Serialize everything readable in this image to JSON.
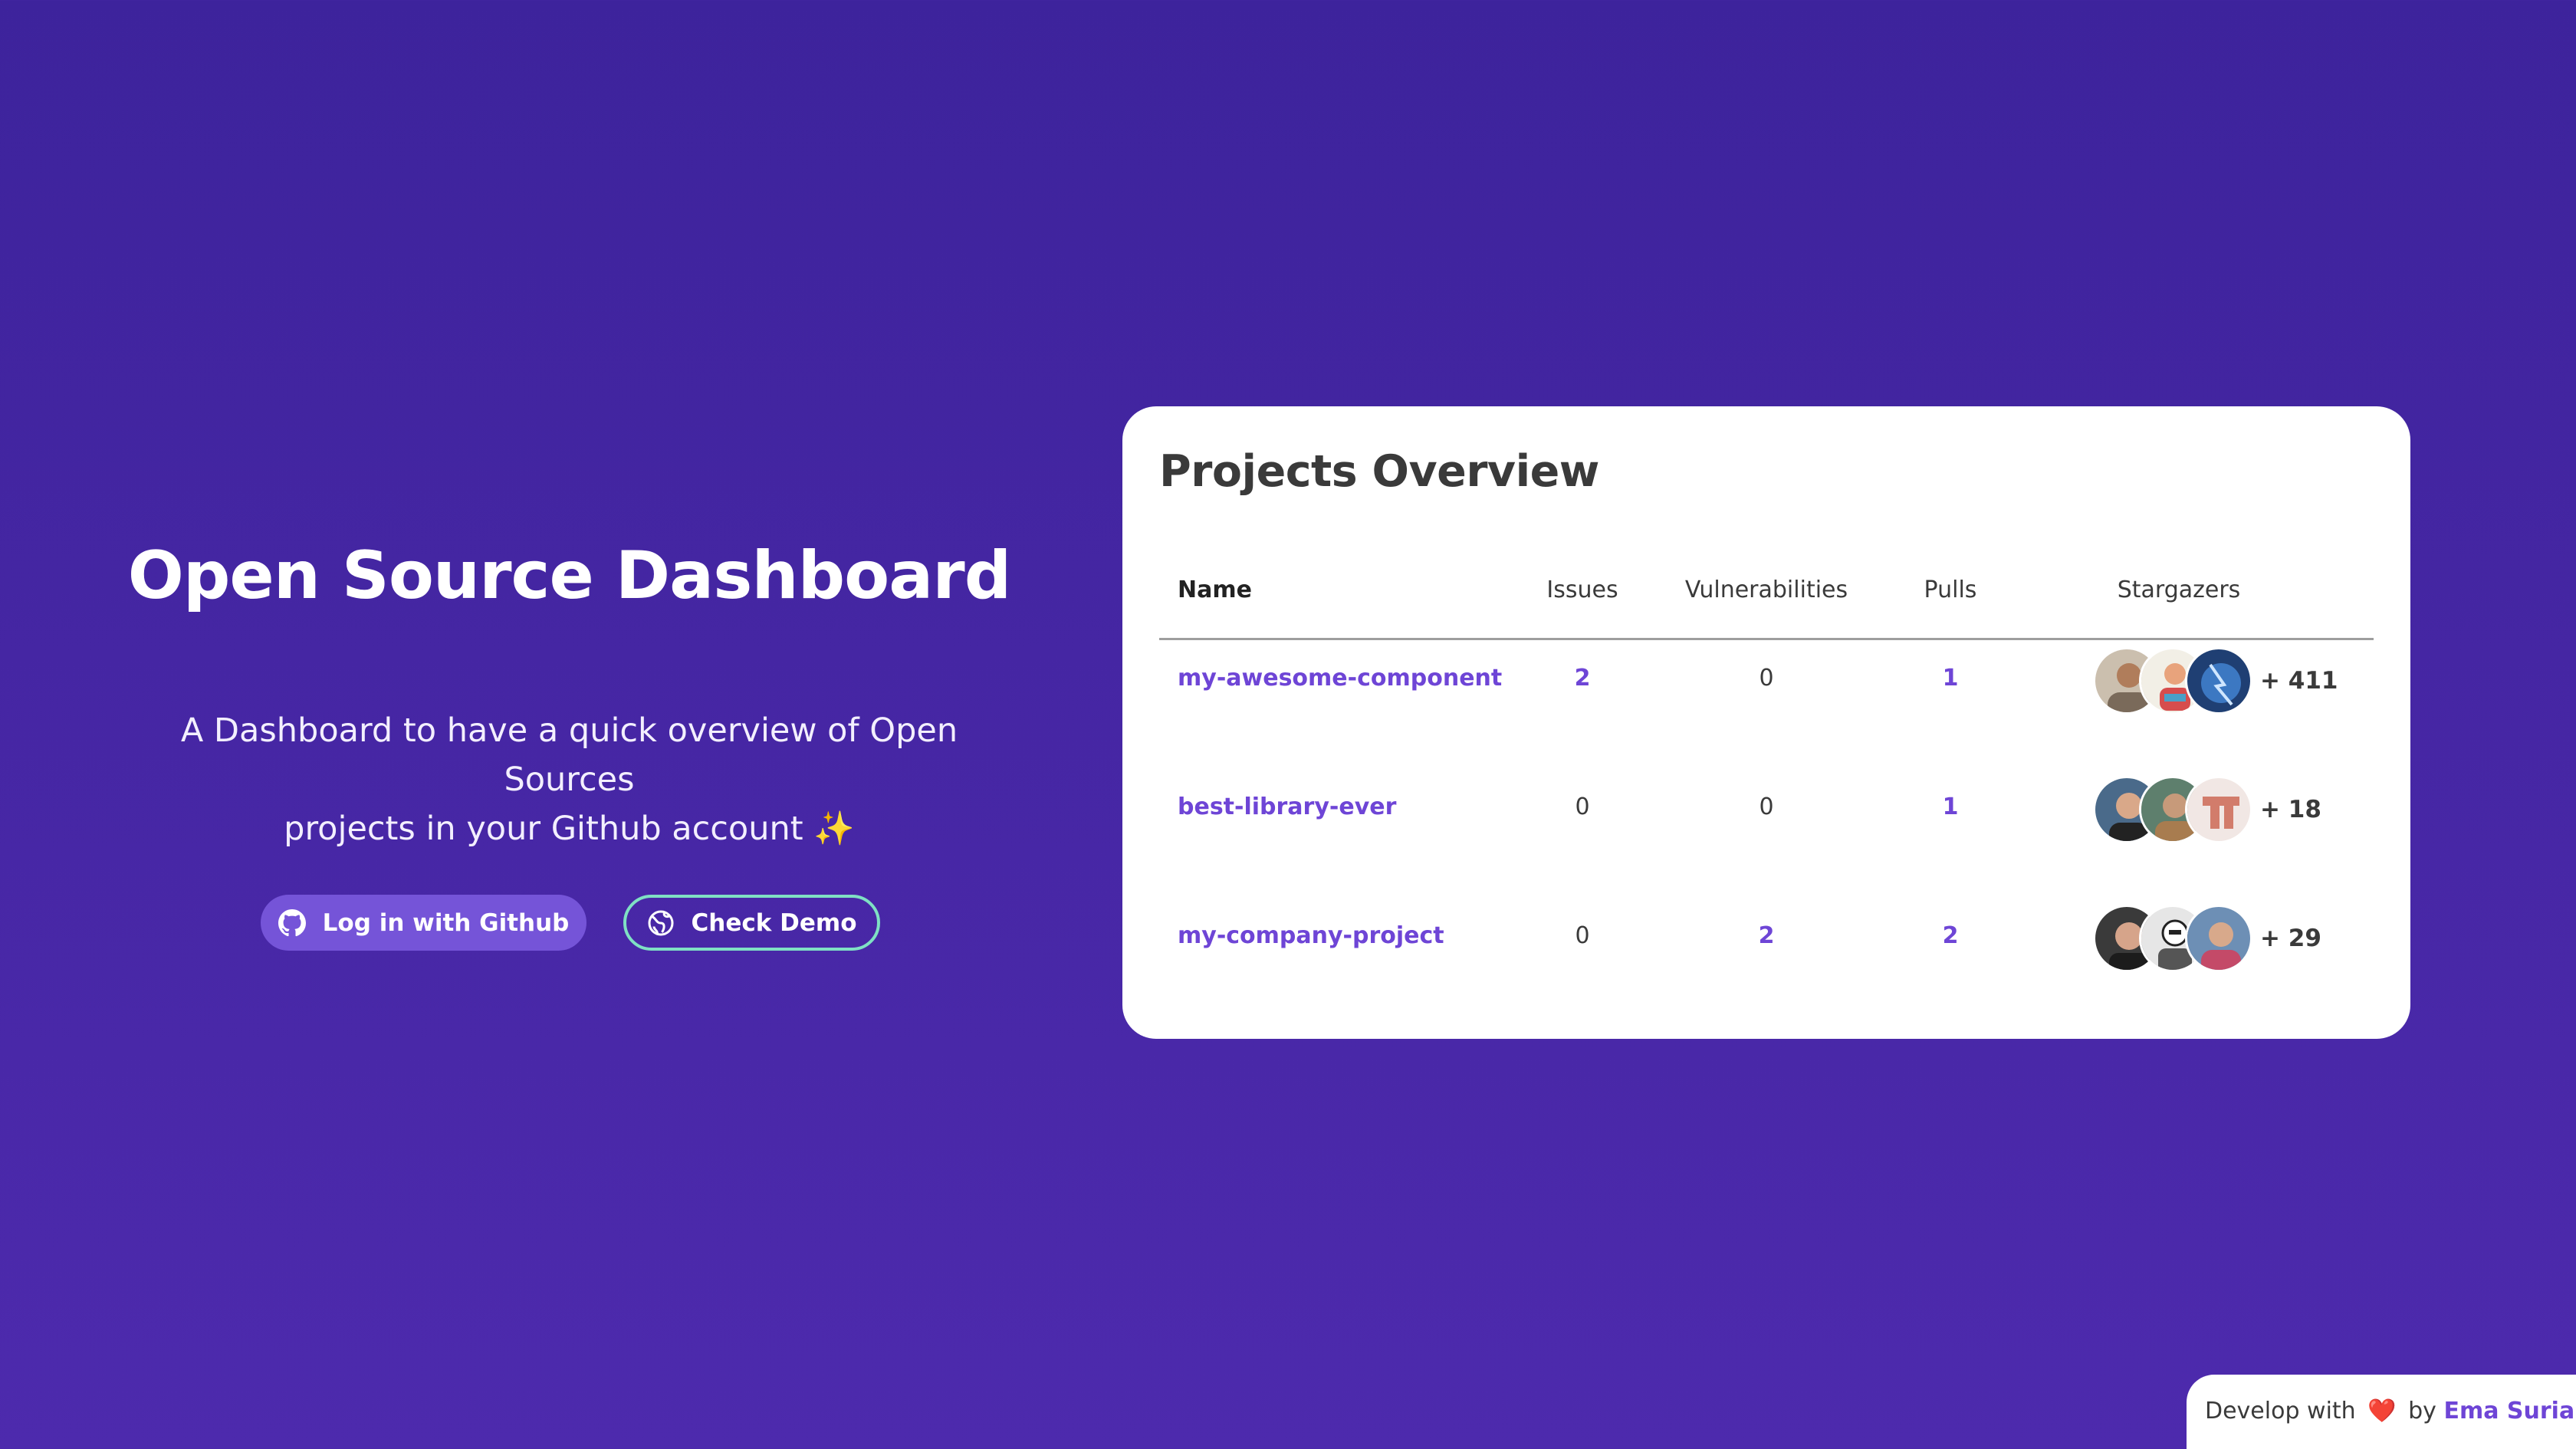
{
  "hero": {
    "title": "Open Source Dashboard",
    "subtitle_line1": "A Dashboard to have a quick overview of Open Sources",
    "subtitle_line2": "projects in your Github account",
    "sparkle": "✨"
  },
  "actions": {
    "login_label": "Log in with Github",
    "login_icon": "github-icon",
    "demo_label": "Check Demo",
    "demo_icon": "globe-icon",
    "demo_border_color": "#7fe0c4",
    "login_bg_color": "#7554d8"
  },
  "overview": {
    "title": "Projects Overview",
    "columns": [
      "Name",
      "Issues",
      "Vulnerabilities",
      "Pulls",
      "Stargazers"
    ],
    "rows": [
      {
        "name": "my-awesome-component",
        "issues": "2",
        "vulnerabilities": "0",
        "pulls": "1",
        "stargazers_more": "+ 411"
      },
      {
        "name": "best-library-ever",
        "issues": "0",
        "vulnerabilities": "0",
        "pulls": "1",
        "stargazers_more": "+ 18"
      },
      {
        "name": "my-company-project",
        "issues": "0",
        "vulnerabilities": "2",
        "pulls": "2",
        "stargazers_more": "+ 29"
      }
    ]
  },
  "footer": {
    "prefix": "Develop with",
    "heart": "❤️",
    "by": "by",
    "author": "Ema Suriano"
  },
  "colors": {
    "accent": "#6e45d6",
    "background": "#4526a3"
  }
}
